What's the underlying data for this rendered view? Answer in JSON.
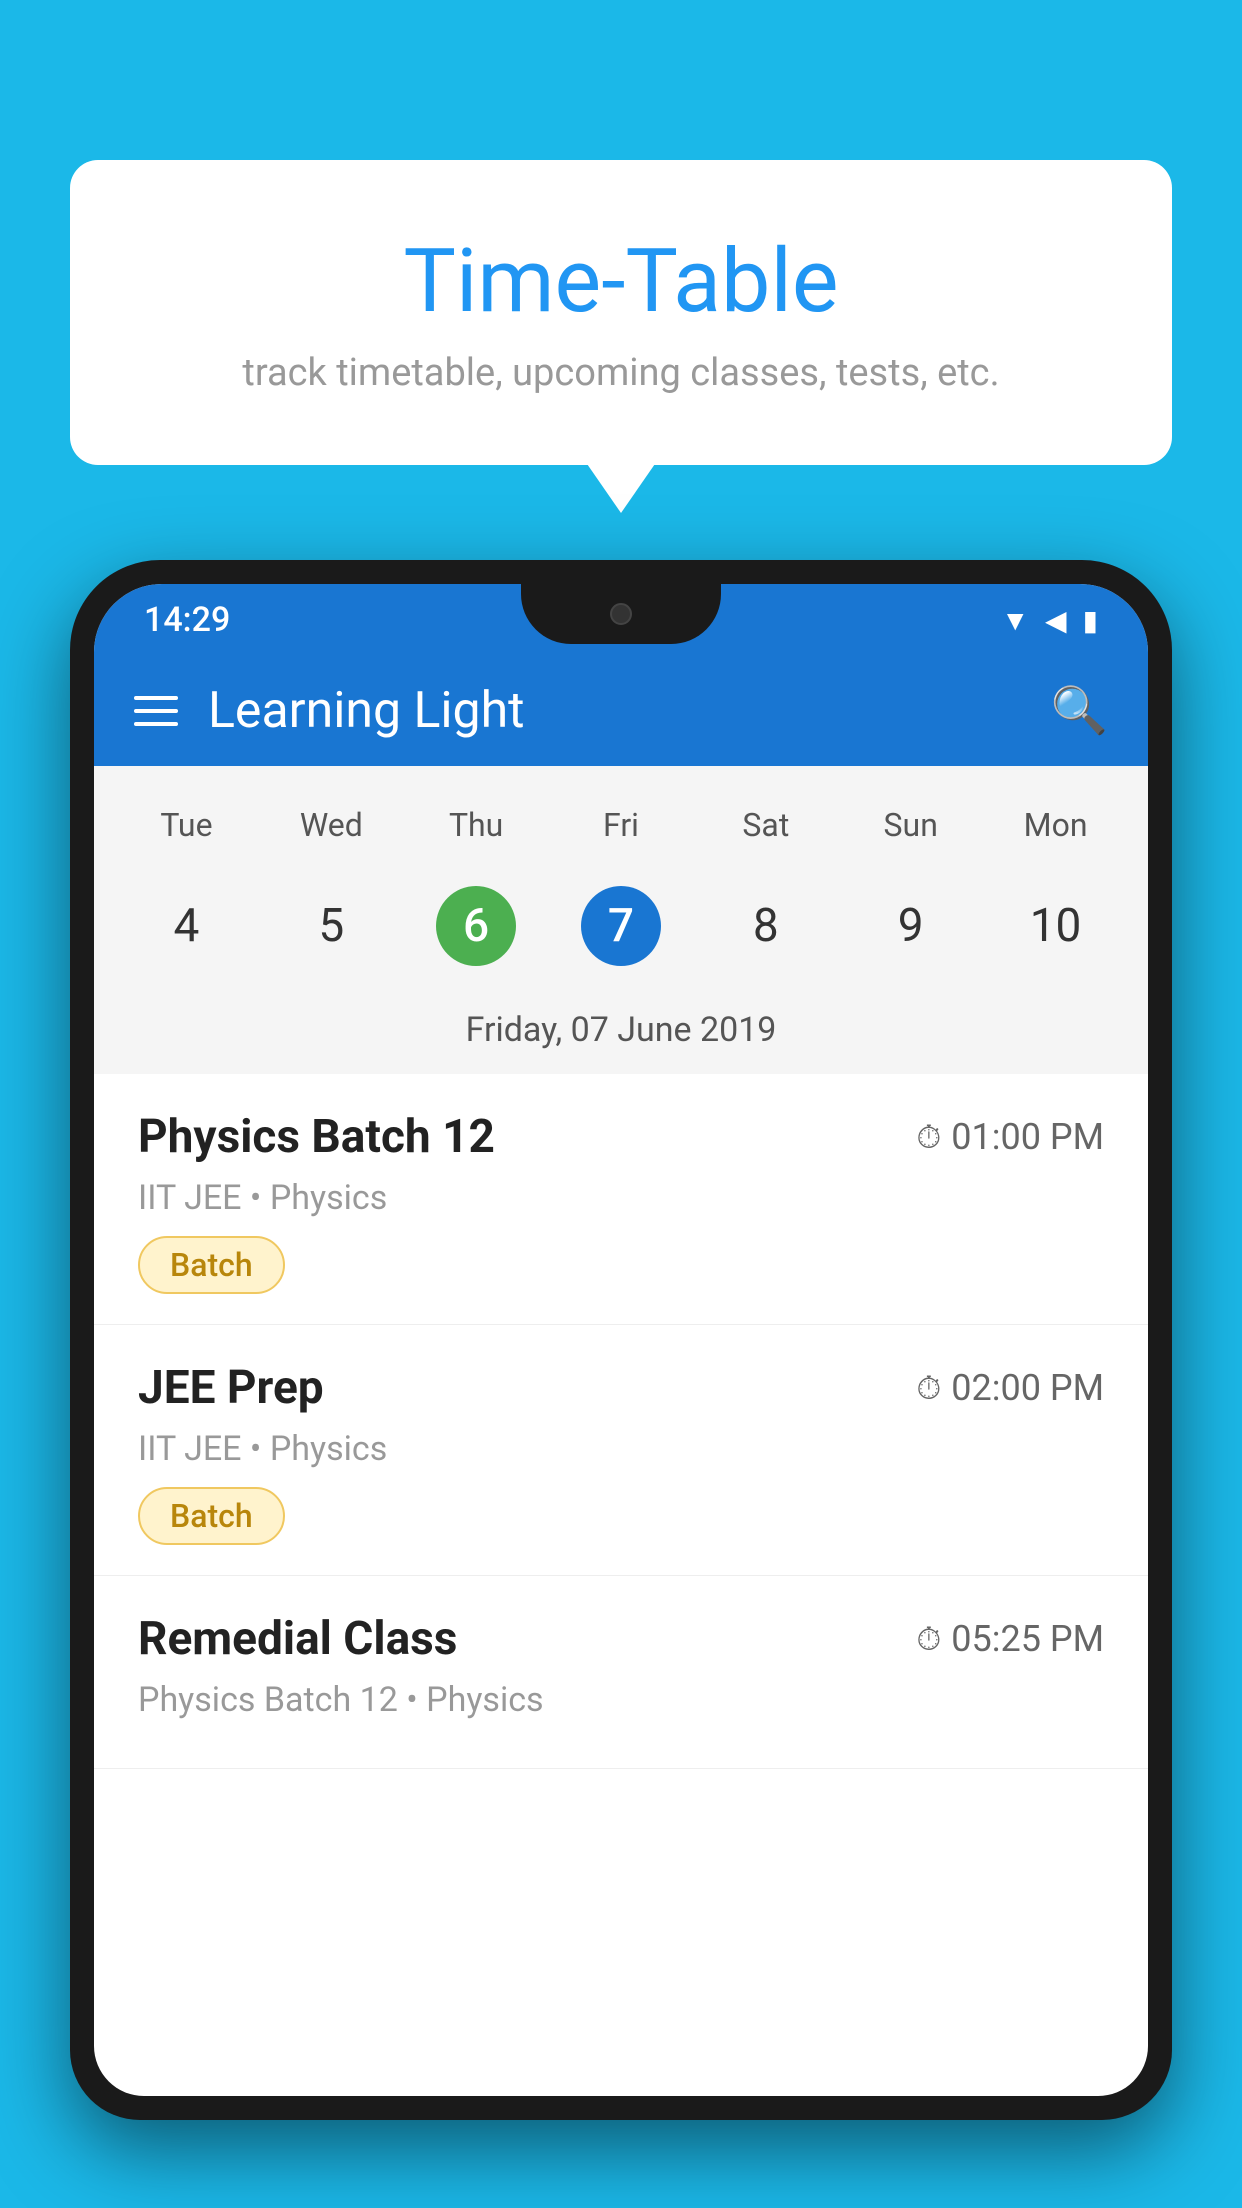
{
  "background_color": "#1bb8e8",
  "bubble": {
    "title": "Time-Table",
    "subtitle": "track timetable, upcoming classes, tests, etc."
  },
  "phone": {
    "status_bar": {
      "time": "14:29"
    },
    "app_bar": {
      "title": "Learning Light"
    },
    "calendar": {
      "day_names": [
        "Tue",
        "Wed",
        "Thu",
        "Fri",
        "Sat",
        "Sun",
        "Mon"
      ],
      "day_numbers": [
        "4",
        "5",
        "6",
        "7",
        "8",
        "9",
        "10"
      ],
      "today_index": 2,
      "selected_index": 3,
      "selected_label": "Friday, 07 June 2019"
    },
    "classes": [
      {
        "name": "Physics Batch 12",
        "time": "01:00 PM",
        "meta": "IIT JEE • Physics",
        "badge": "Batch"
      },
      {
        "name": "JEE Prep",
        "time": "02:00 PM",
        "meta": "IIT JEE • Physics",
        "badge": "Batch"
      },
      {
        "name": "Remedial Class",
        "time": "05:25 PM",
        "meta": "Physics Batch 12 • Physics",
        "badge": null
      }
    ]
  },
  "icons": {
    "menu": "☰",
    "search": "🔍",
    "clock": "⏱"
  }
}
